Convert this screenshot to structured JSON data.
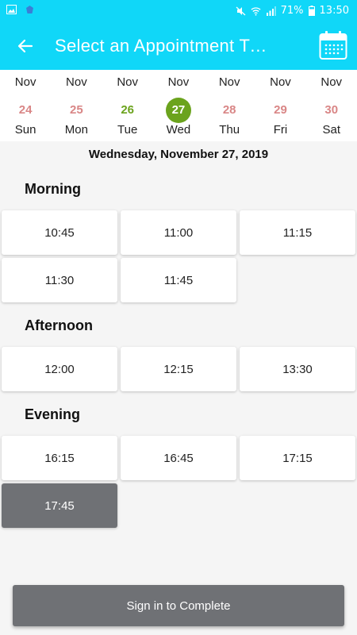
{
  "status_bar": {
    "battery": "71%",
    "time": "13:50"
  },
  "app_bar": {
    "title": "Select an Appointment Time"
  },
  "week": [
    {
      "month": "Nov",
      "day": "24",
      "dow": "Sun"
    },
    {
      "month": "Nov",
      "day": "25",
      "dow": "Mon"
    },
    {
      "month": "Nov",
      "day": "26",
      "dow": "Tue"
    },
    {
      "month": "Nov",
      "day": "27",
      "dow": "Wed"
    },
    {
      "month": "Nov",
      "day": "28",
      "dow": "Thu"
    },
    {
      "month": "Nov",
      "day": "29",
      "dow": "Fri"
    },
    {
      "month": "Nov",
      "day": "30",
      "dow": "Sat"
    }
  ],
  "selected_date": "Wednesday, November 27, 2019",
  "sections": {
    "morning": {
      "title": "Morning",
      "slots": [
        "10:45",
        "11:00",
        "11:15",
        "11:30",
        "11:45"
      ]
    },
    "afternoon": {
      "title": "Afternoon",
      "slots": [
        "12:00",
        "12:15",
        "13:30"
      ]
    },
    "evening": {
      "title": "Evening",
      "slots": [
        "16:15",
        "16:45",
        "17:15",
        "17:45"
      ]
    }
  },
  "cta_label": "Sign in to Complete",
  "colors": {
    "primary": "#10d7f8",
    "selected_day": "#6ba31d",
    "other_day": "#d98686",
    "active_slot": "#6f7175"
  }
}
